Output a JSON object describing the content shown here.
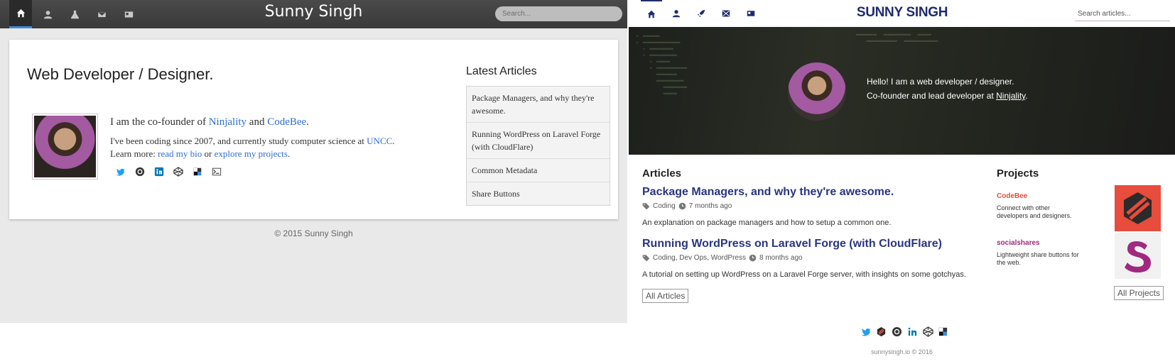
{
  "old_site": {
    "nav": {
      "icons": [
        "home-icon",
        "user-icon",
        "flask-icon",
        "mail-icon",
        "card-icon"
      ],
      "brand": "Sunny Singh",
      "search_placeholder": "Search..."
    },
    "headline": "Web Developer / Designer.",
    "bio": {
      "line1_prefix": "I am the co-founder of ",
      "ninjality": "Ninjality",
      "and": " and ",
      "codebee": "CodeBee",
      "line1_suffix": ".",
      "line2_prefix": "I've been coding since 2007, and currently study computer science at ",
      "uncc": "UNCC",
      "line2_suffix": ".",
      "line3_prefix": "Learn more: ",
      "read_bio": "read my bio",
      "or": " or ",
      "explore_projects": "explore my projects",
      "line3_suffix": "."
    },
    "socials": [
      "twitter-icon",
      "github-icon",
      "linkedin-icon",
      "codepen-icon",
      "delicious-icon",
      "terminal-icon"
    ],
    "sidebar": {
      "title": "Latest Articles",
      "items": [
        "Package Managers, and why they're awesome.",
        "Running WordPress on Laravel Forge (with CloudFlare)",
        "Common Metadata",
        "Share Buttons"
      ]
    },
    "footer": "© 2015 Sunny Singh"
  },
  "new_site": {
    "nav": {
      "icons": [
        "home-icon",
        "user-icon",
        "rocket-icon",
        "mail-icon",
        "card-icon"
      ],
      "brand": "SUNNY SINGH",
      "search_placeholder": "Search articles..."
    },
    "hero": {
      "line1": "Hello! I am a web developer / designer.",
      "line2_prefix": "Co-founder and lead developer at ",
      "ninjality": "Ninjality",
      "line2_suffix": "."
    },
    "articles_title": "Articles",
    "articles": [
      {
        "title": "Package Managers, and why they're awesome.",
        "tags": "Coding",
        "time": "7 months ago",
        "desc": "An explanation on package managers and how to setup a common one."
      },
      {
        "title": "Running WordPress on Laravel Forge (with CloudFlare)",
        "tags": "Coding, Dev Ops, WordPress",
        "time": "8 months ago",
        "desc": "A tutorial on setting up WordPress on a Laravel Forge server, with insights on some gotchyas."
      }
    ],
    "all_articles": "All Articles",
    "projects_title": "Projects",
    "projects": [
      {
        "name": "CodeBee",
        "desc": "Connect with other developers and designers.",
        "color": "#e74c3c"
      },
      {
        "name": "socialshares",
        "desc": "Lightweight share buttons for the web.",
        "color": "#a0287f"
      }
    ],
    "all_projects": "All Projects",
    "footer_icons": [
      "twitter-icon",
      "codebee-icon",
      "github-icon",
      "linkedin-icon",
      "codepen-icon",
      "delicious-icon"
    ],
    "copyright": "sunnysingh.io © 2016"
  },
  "colors": {
    "old_accent": "#3d8ae0",
    "old_link": "#2f6fd0",
    "new_brand": "#1e2c6e",
    "new_article_title": "#2a3580",
    "codebee": "#e74c3c",
    "socialshares": "#a0287f",
    "twitter": "#1da1f2",
    "linkedin": "#0077b5"
  }
}
